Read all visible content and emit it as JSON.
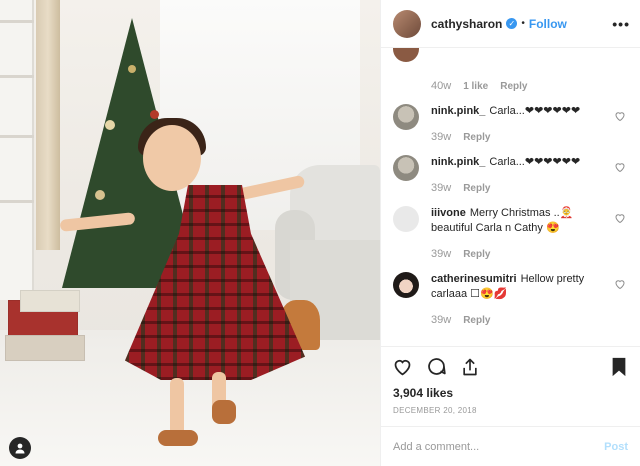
{
  "header": {
    "username": "cathysharon",
    "dot": "•",
    "follow_label": "Follow",
    "more_label": "•••"
  },
  "top_comment": {
    "time": "40w",
    "likes": "1 like",
    "reply": "Reply"
  },
  "comments": [
    {
      "username": "nink.pink_",
      "text": "Carla...❤❤❤❤❤❤",
      "time": "39w",
      "reply": "Reply"
    },
    {
      "username": "nink.pink_",
      "text": "Carla...❤❤❤❤❤❤",
      "time": "39w",
      "reply": "Reply"
    },
    {
      "username": "iiivone",
      "text": "Merry Christmas ..🤶 beautiful Carla n Cathy 😍",
      "time": "39w",
      "reply": "Reply"
    },
    {
      "username": "catherinesumitri",
      "text": "Hellow pretty carlaaa ☐😍💋",
      "time": "39w",
      "reply": "Reply"
    }
  ],
  "likes_count": "3,904 likes",
  "post_date": "DECEMBER 20, 2018",
  "add_comment": {
    "placeholder": "Add a comment...",
    "post_label": "Post"
  },
  "colors": {
    "accent": "#3897f0",
    "post_disabled": "#b2dffc",
    "text": "#262626",
    "muted": "#999999"
  },
  "icons": [
    "heart-icon",
    "comment-icon",
    "share-icon",
    "bookmark-icon",
    "user-tag-icon",
    "verified-badge-icon"
  ]
}
